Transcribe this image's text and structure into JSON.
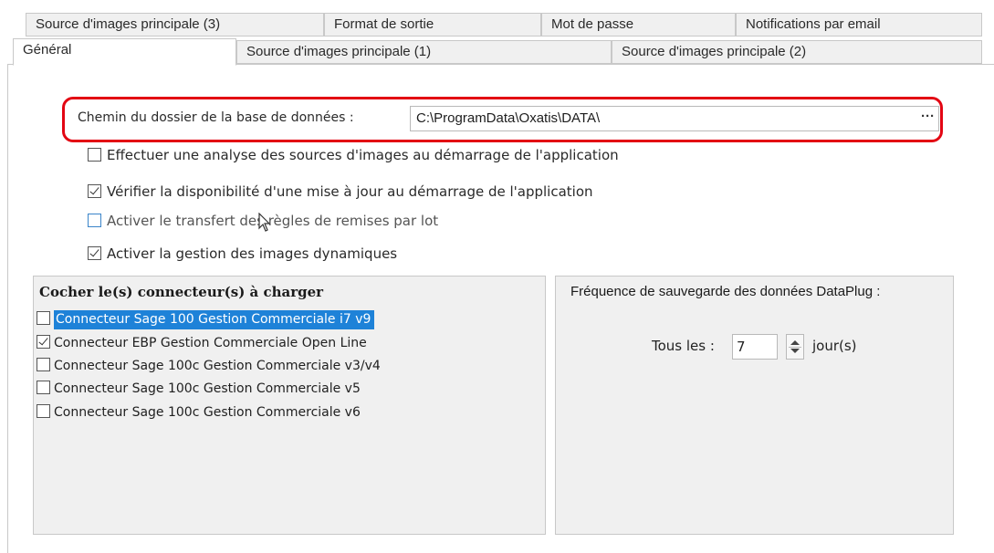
{
  "tabs_row1": [
    {
      "label": "Source d'images principale (3)"
    },
    {
      "label": "Format de sortie"
    },
    {
      "label": "Mot de passe"
    },
    {
      "label": "Notifications par email"
    }
  ],
  "tabs_row2": [
    {
      "label": "Général",
      "active": true
    },
    {
      "label": "Source d'images principale (1)"
    },
    {
      "label": "Source d'images principale (2)"
    }
  ],
  "database": {
    "label": "Chemin du dossier de la base de données :",
    "value": "C:\\ProgramData\\Oxatis\\DATA\\",
    "browse_label": "···"
  },
  "options": [
    {
      "label": "Effectuer une analyse des sources d'images au démarrage de l'application",
      "checked": false
    },
    {
      "label": "Vérifier la disponibilité d'une mise à jour au démarrage de l'application",
      "checked": true
    },
    {
      "label": "Activer le transfert des règles de remises par lot",
      "checked": false
    },
    {
      "label": "Activer la gestion des images dynamiques",
      "checked": true
    }
  ],
  "connectors": {
    "title": "Cocher le(s) connecteur(s) à charger",
    "items": [
      {
        "label": "Connecteur Sage 100 Gestion Commerciale i7 v9",
        "checked": false,
        "selected": true
      },
      {
        "label": "Connecteur EBP Gestion Commerciale Open Line",
        "checked": true,
        "selected": false
      },
      {
        "label": "Connecteur Sage 100c Gestion Commerciale v3/v4",
        "checked": false,
        "selected": false
      },
      {
        "label": "Connecteur Sage 100c Gestion Commerciale v5",
        "checked": false,
        "selected": false
      },
      {
        "label": "Connecteur Sage 100c Gestion Commerciale v6",
        "checked": false,
        "selected": false
      }
    ]
  },
  "backup": {
    "title": "Fréquence de sauvegarde des données DataPlug :",
    "every_label": "Tous les :",
    "value": "7",
    "unit": "jour(s)"
  },
  "colors": {
    "highlight_border": "#e30613",
    "selection": "#1e82d8"
  }
}
